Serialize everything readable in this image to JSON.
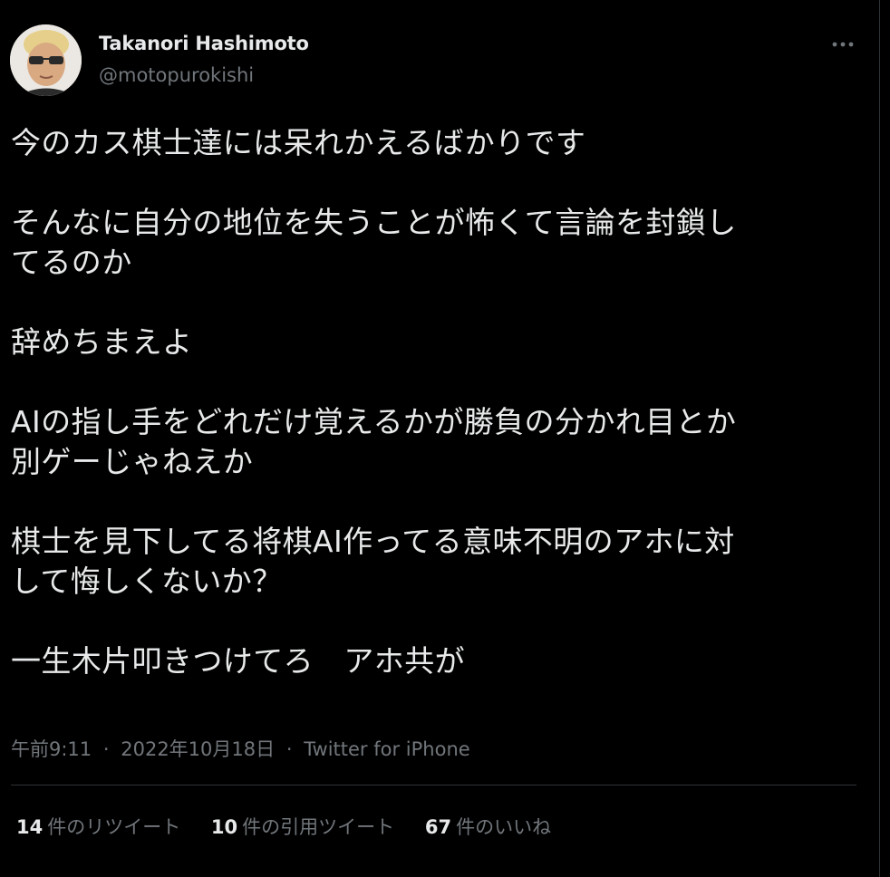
{
  "author": {
    "name": "Takanori Hashimoto",
    "handle": "@motopurokishi"
  },
  "tweet": {
    "text": "今のカス棋士達には呆れかえるばかりです\n\nそんなに自分の地位を失うことが怖くて言論を封鎖し\nてるのか\n\n辞めちまえよ\n\nAIの指し手をどれだけ覚えるかが勝負の分かれ目とか\n別ゲーじゃねえか\n\n棋士を見下してる将棋AI作ってる意味不明のアホに対\nして悔しくないか？\n\n一生木片叩きつけてろ　アホ共が"
  },
  "meta": {
    "time": "午前9:11",
    "separator": "·",
    "date": "2022年10月18日",
    "source": "Twitter for iPhone"
  },
  "stats": {
    "retweets": {
      "count": "14",
      "label": "件のリツイート"
    },
    "quotes": {
      "count": "10",
      "label": "件の引用ツイート"
    },
    "likes": {
      "count": "67",
      "label": "件のいいね"
    }
  },
  "icons": {
    "more": "more-horizontal-icon"
  },
  "colors": {
    "background": "#000000",
    "primary_text": "#e7e9ea",
    "secondary_text": "#71767b",
    "divider": "#2f3336"
  }
}
